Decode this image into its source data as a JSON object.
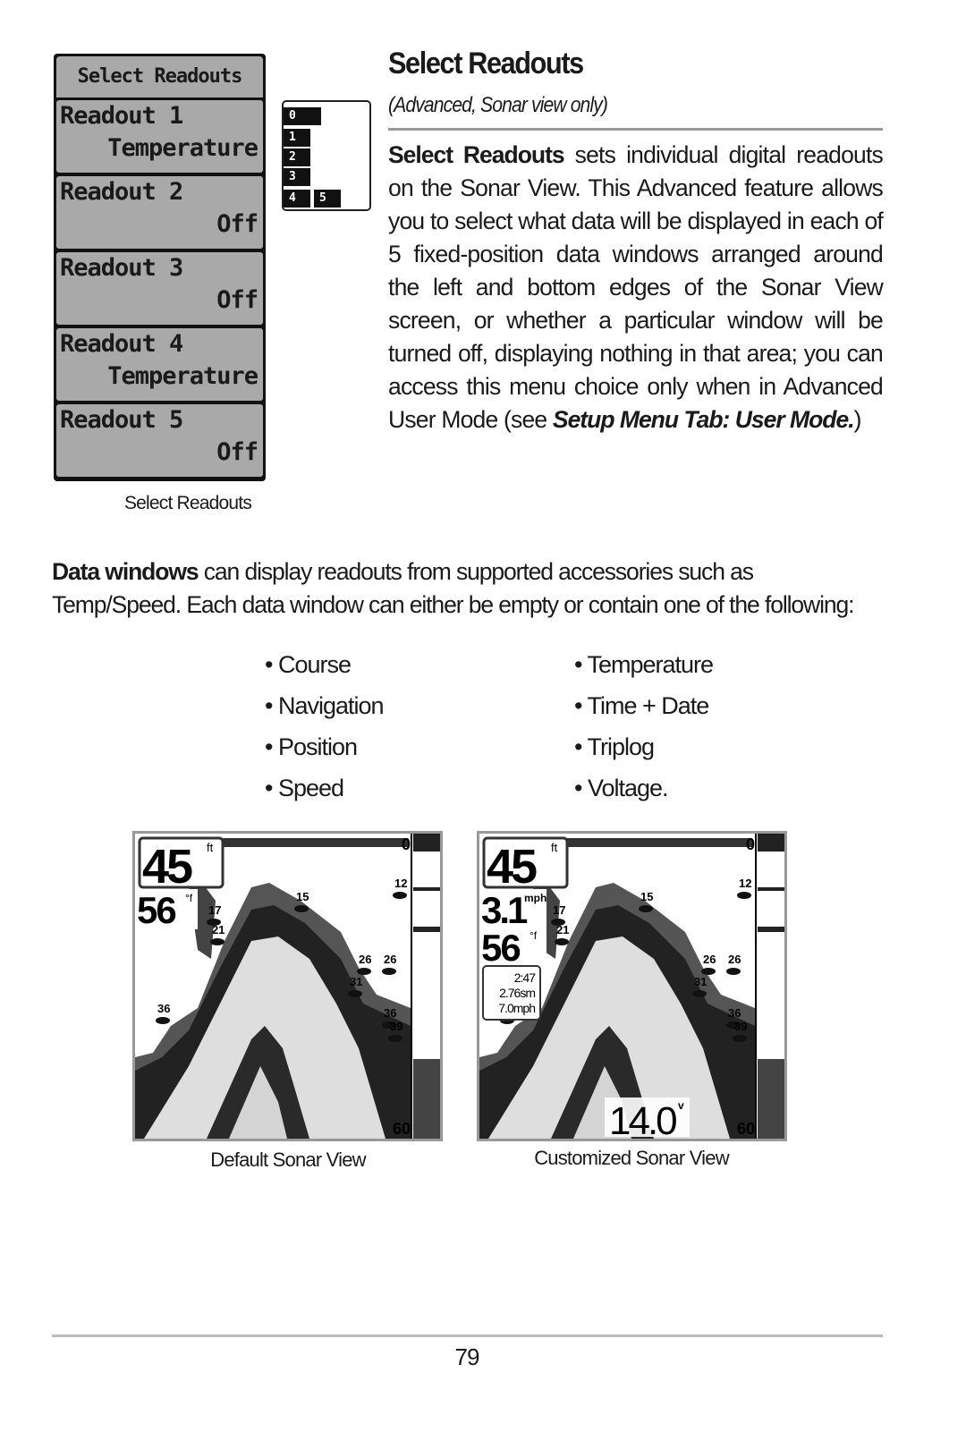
{
  "menu": {
    "title": "Select Readouts",
    "items": [
      {
        "label": "Readout 1",
        "value": "Temperature"
      },
      {
        "label": "Readout 2",
        "value": "Off"
      },
      {
        "label": "Readout 3",
        "value": "Off"
      },
      {
        "label": "Readout 4",
        "value": "Temperature"
      },
      {
        "label": "Readout 5",
        "value": "Off"
      }
    ],
    "caption": "Select Readouts"
  },
  "layout_diagram": {
    "cells": [
      "0",
      "1",
      "2",
      "3",
      "4",
      "5"
    ]
  },
  "section": {
    "title": "Select Readouts",
    "subtitle": "(Advanced, Sonar view only)",
    "p_lead": "Select Readouts",
    "p_text": " sets individual digital readouts on the Sonar View. This Advanced feature allows you to select what data will be displayed in each of 5 fixed-position data windows arranged around the left and bottom edges of the Sonar View screen, or whether a particular window will be turned off, displaying nothing in that area; you can access this menu choice only when in Advanced User Mode (see ",
    "p_ref": "Setup Menu Tab: User Mode.",
    "p_end": ")"
  },
  "data_windows": {
    "lead": "Data windows",
    "text": " can display readouts from supported accessories such as Temp/Speed. Each data window can either be empty or contain one of the following:",
    "bullets_left": [
      "• Course",
      "• Navigation",
      "• Position",
      "• Speed"
    ],
    "bullets_right": [
      "• Temperature",
      "• Time + Date",
      "• Triplog",
      "• Voltage."
    ]
  },
  "sonar_default": {
    "caption": "Default Sonar View",
    "depth": "45",
    "depth_unit": "ft",
    "temp": "56",
    "temp_unit": "°f",
    "scale_top": "0",
    "scale_bottom": "60",
    "fish": [
      "12",
      "15",
      "17",
      "21",
      "26",
      "26",
      "31",
      "36",
      "36",
      "39"
    ]
  },
  "sonar_custom": {
    "caption": "Customized Sonar View",
    "depth": "45",
    "depth_unit": "ft",
    "speed": "3.1",
    "speed_unit": "mph",
    "temp": "56",
    "temp_unit": "°f",
    "triplog": [
      "2:47",
      "2.76sm",
      "7.0mph"
    ],
    "voltage": "14.0",
    "voltage_unit": "v",
    "scale_top": "0",
    "scale_bottom": "60",
    "fish": [
      "12",
      "15",
      "17",
      "21",
      "26",
      "26",
      "31",
      "36",
      "36",
      "39"
    ]
  },
  "footer": {
    "page_number": "79"
  }
}
